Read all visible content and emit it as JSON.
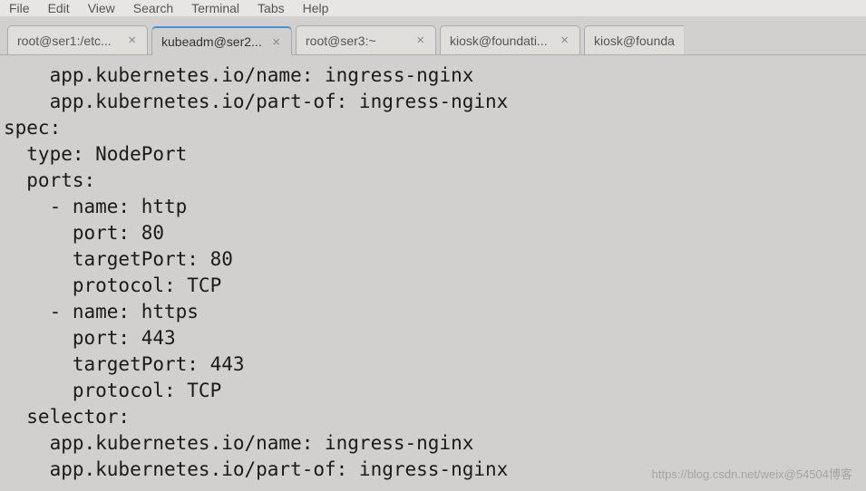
{
  "menu": {
    "items": [
      "File",
      "Edit",
      "View",
      "Search",
      "Terminal",
      "Tabs",
      "Help"
    ]
  },
  "tabs": [
    {
      "label": "root@ser1:/etc...",
      "active": false
    },
    {
      "label": "kubeadm@ser2...",
      "active": true
    },
    {
      "label": "root@ser3:~",
      "active": false
    },
    {
      "label": "kiosk@foundati...",
      "active": false
    },
    {
      "label": "kiosk@founda",
      "active": false,
      "noclose": true
    }
  ],
  "terminal_lines": [
    "    app.kubernetes.io/name: ingress-nginx",
    "    app.kubernetes.io/part-of: ingress-nginx",
    "spec:",
    "  type: NodePort",
    "  ports:",
    "    - name: http",
    "      port: 80",
    "      targetPort: 80",
    "      protocol: TCP",
    "    - name: https",
    "      port: 443",
    "      targetPort: 443",
    "      protocol: TCP",
    "  selector:",
    "    app.kubernetes.io/name: ingress-nginx",
    "    app.kubernetes.io/part-of: ingress-nginx"
  ],
  "watermark": "https://blog.csdn.net/weix@54504博客"
}
